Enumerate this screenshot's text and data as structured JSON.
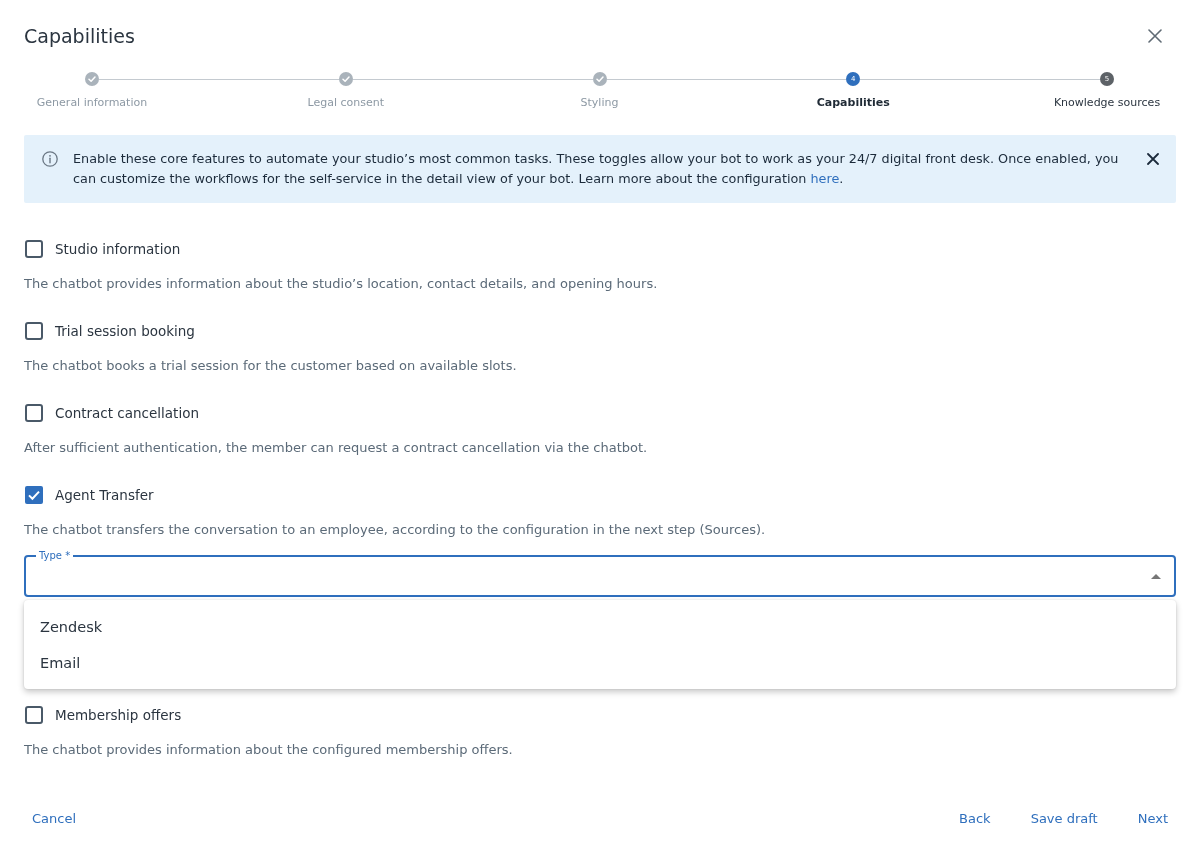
{
  "dialog": {
    "title": "Capabilities"
  },
  "stepper": [
    {
      "label": "General information",
      "completed": true,
      "selected": false
    },
    {
      "label": "Legal consent",
      "completed": true,
      "selected": false
    },
    {
      "label": "Styling",
      "completed": true,
      "selected": false
    },
    {
      "label": "Capabilities",
      "completed": false,
      "selected": true,
      "number": "4"
    },
    {
      "label": "Knowledge sources",
      "completed": false,
      "selected": false,
      "number": "5"
    }
  ],
  "info_banner": {
    "text": "Enable these core features to automate your studio’s most common tasks. These toggles allow your bot to work as your 24/7 digital front desk. Once enabled, you can customize the workflows for the self-service in the detail view of your bot. Learn more about the configuration ",
    "link": "here",
    "text_after": "."
  },
  "capabilities": [
    {
      "label": "Studio information",
      "checked": false,
      "description": "The chatbot provides information about the studio’s location, contact details, and opening hours."
    },
    {
      "label": "Trial session booking",
      "checked": false,
      "description": "The chatbot books a trial session for the customer based on available slots."
    },
    {
      "label": "Contract cancellation",
      "checked": false,
      "description": "After sufficient authentication, the member can request a contract cancellation via the chatbot."
    },
    {
      "label": "Agent Transfer",
      "checked": true,
      "description": "The chatbot transfers the conversation to an employee, according to the configuration in the next step (Sources).",
      "field": {
        "label": "Type *",
        "expanded": true,
        "options": [
          "Zendesk",
          "Email"
        ]
      }
    },
    {
      "label": "Membership offers",
      "checked": false,
      "description": "The chatbot provides information about the configured membership offers."
    }
  ],
  "footer": {
    "left_buttons": [
      "Cancel"
    ],
    "right_buttons": [
      "Back",
      "Save draft",
      "Next"
    ]
  }
}
